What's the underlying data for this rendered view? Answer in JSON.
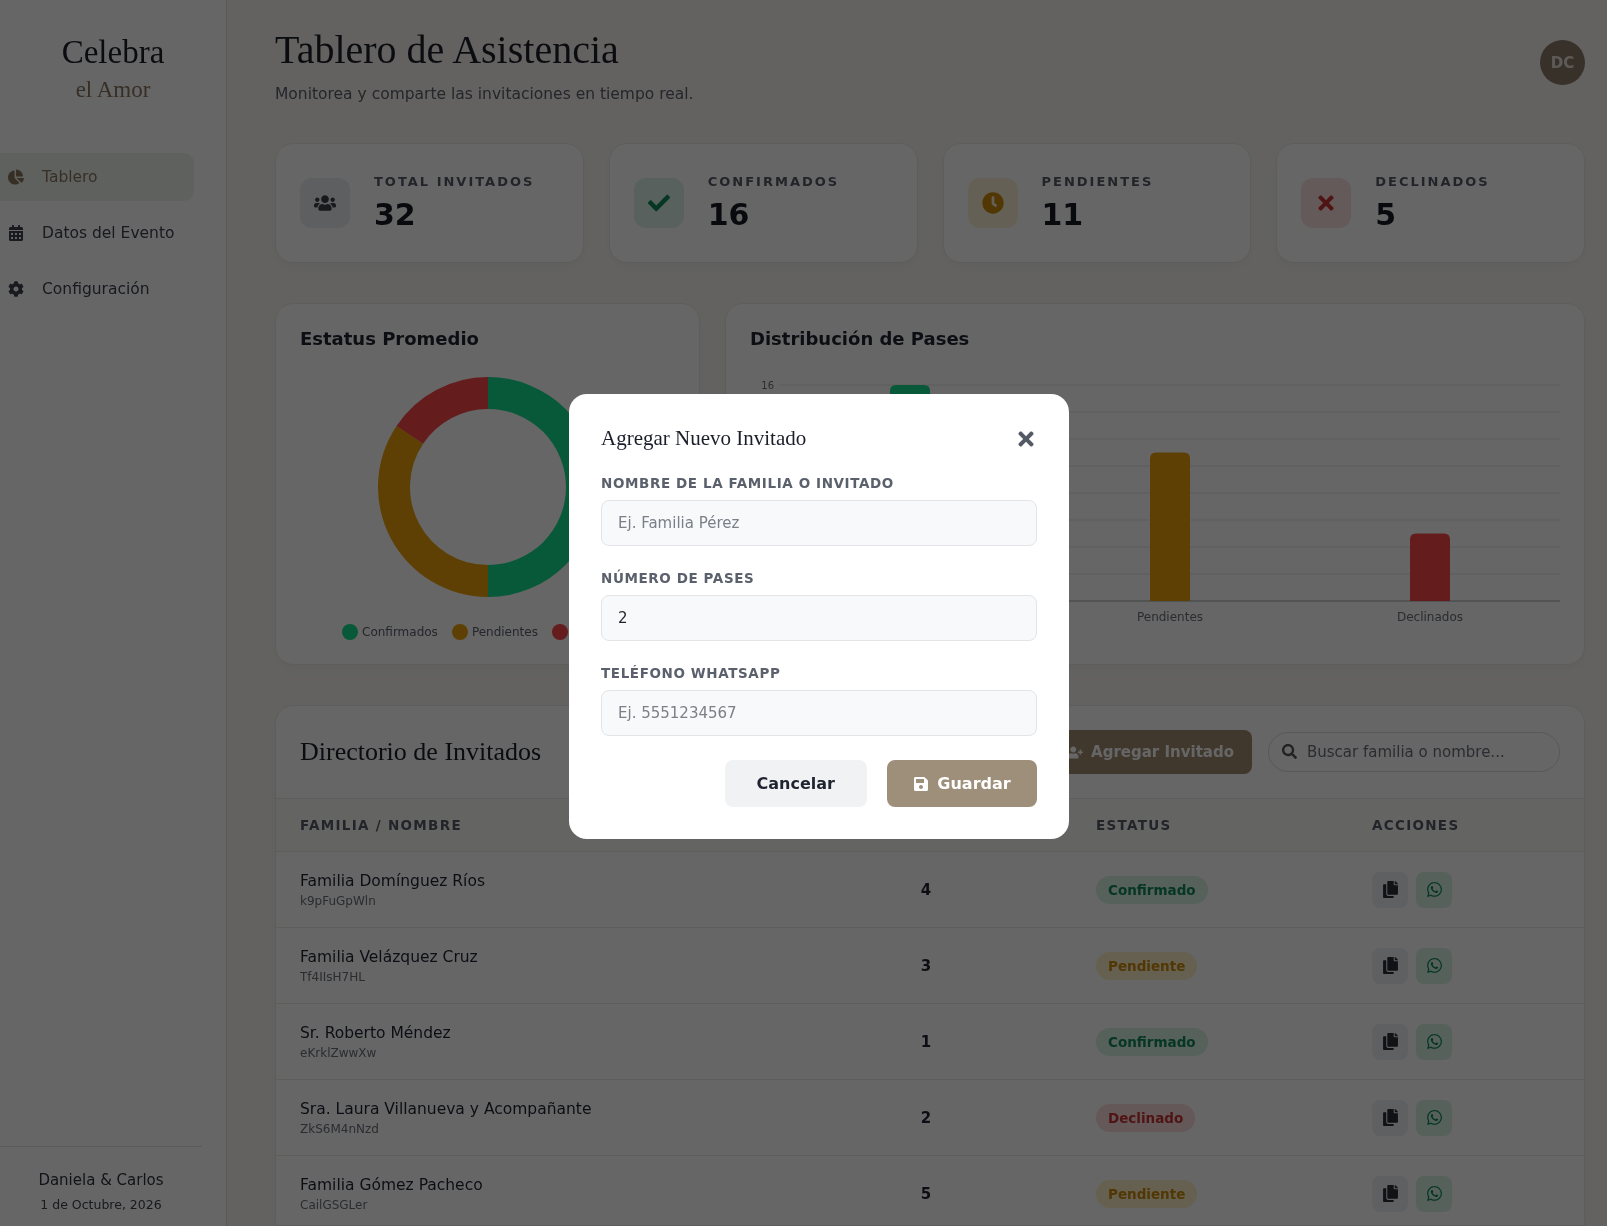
{
  "sidebar": {
    "logo_line_1": "Celebra",
    "logo_line_2": "el Amor",
    "items": [
      {
        "label": "Tablero",
        "selected": true
      },
      {
        "label": "Datos del Evento",
        "selected": false
      },
      {
        "label": "Configuración",
        "selected": false
      }
    ],
    "footer": {
      "couple": "Daniela & Carlos",
      "date": "1 de Octubre, 2026"
    }
  },
  "header": {
    "title": "Tablero de Asistencia",
    "subtitle": "Monitorea y comparte las invitaciones en tiempo real.",
    "avatar": "DC"
  },
  "stats": [
    {
      "kind": "total",
      "label": "TOTAL INVITADOS",
      "value": "32"
    },
    {
      "kind": "confirmed",
      "label": "CONFIRMADOS",
      "value": "16"
    },
    {
      "kind": "pending",
      "label": "PENDIENTES",
      "value": "11"
    },
    {
      "kind": "declined",
      "label": "DECLINADOS",
      "value": "5"
    }
  ],
  "status_chart": {
    "title": "Estatus Promedio",
    "legend": [
      {
        "label": "Confirmados",
        "color": "#08583a"
      },
      {
        "label": "Pendientes",
        "color": "#5e4004"
      },
      {
        "color": "#641c1c"
      }
    ]
  },
  "passes_chart": {
    "title": "Distribución de Pases",
    "top_tick": "16",
    "labels": [
      "Pendientes",
      "Declinados"
    ]
  },
  "directory": {
    "title": "Directorio de Invitados",
    "add_button": "Agregar Invitado",
    "search": {
      "placeholder": "Buscar familia o nombre..."
    },
    "columns": [
      "FAMILIA / NOMBRE",
      "ESTATUS",
      "ACCIONES"
    ],
    "rows": [
      {
        "name": "Familia Domínguez Ríos",
        "code": "k9pFuGpWln",
        "passes": "4",
        "status": "Confirmado",
        "kind": "confirmed"
      },
      {
        "name": "Familia Velázquez Cruz",
        "code": "Tf4IIsH7HL",
        "passes": "3",
        "status": "Pendiente",
        "kind": "pending"
      },
      {
        "name": "Sr. Roberto Méndez",
        "code": "eKrklZwwXw",
        "passes": "1",
        "status": "Confirmado",
        "kind": "confirmed"
      },
      {
        "name": "Sra. Laura Villanueva y Acompañante",
        "code": "ZkS6M4nNzd",
        "passes": "2",
        "status": "Declinado",
        "kind": "declined"
      },
      {
        "name": "Familia Gómez Pacheco",
        "code": "CailGSGLer",
        "passes": "5",
        "status": "Pendiente",
        "kind": "pending"
      }
    ]
  },
  "modal": {
    "title": "Agregar Nuevo Invitado",
    "fields": [
      {
        "label": "NOMBRE DE LA FAMILIA O INVITADO",
        "placeholder": "Ej. Familia Pérez"
      },
      {
        "label": "NÚMERO DE PASES",
        "value": "2"
      },
      {
        "label": "TELÉFONO WHATSAPP",
        "placeholder": "Ej. 5551234567"
      }
    ],
    "cancel": "Cancelar",
    "save": "Guardar"
  }
}
